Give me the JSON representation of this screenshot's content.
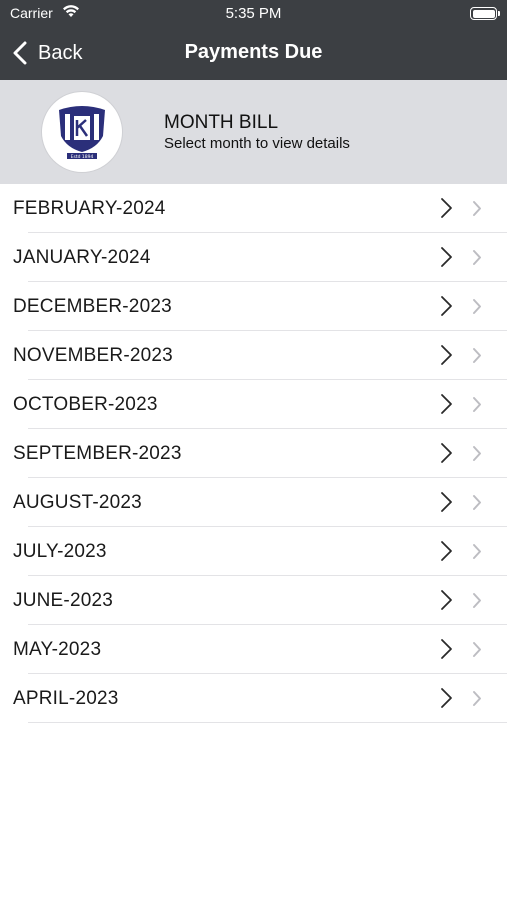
{
  "status_bar": {
    "carrier": "Carrier",
    "time": "5:35 PM"
  },
  "nav": {
    "back_label": "Back",
    "title": "Payments Due"
  },
  "header": {
    "title": "MONTH BILL",
    "subtitle": "Select month to view details",
    "logo_text": "Estd 1894"
  },
  "months": [
    "FEBRUARY-2024",
    "JANUARY-2024",
    "DECEMBER-2023",
    "NOVEMBER-2023",
    "OCTOBER-2023",
    "SEPTEMBER-2023",
    "AUGUST-2023",
    "JULY-2023",
    "JUNE-2023",
    "MAY-2023",
    "APRIL-2023"
  ],
  "colors": {
    "navbar": "#3c3f43",
    "header_bg": "#dcdde1",
    "logo_accent": "#2b2f7a"
  },
  "icons": {
    "back": "chevron-left-icon",
    "row_primary": "chevron-right-icon",
    "row_secondary": "disclosure-indicator-icon",
    "wifi": "wifi-icon",
    "battery": "battery-icon"
  }
}
